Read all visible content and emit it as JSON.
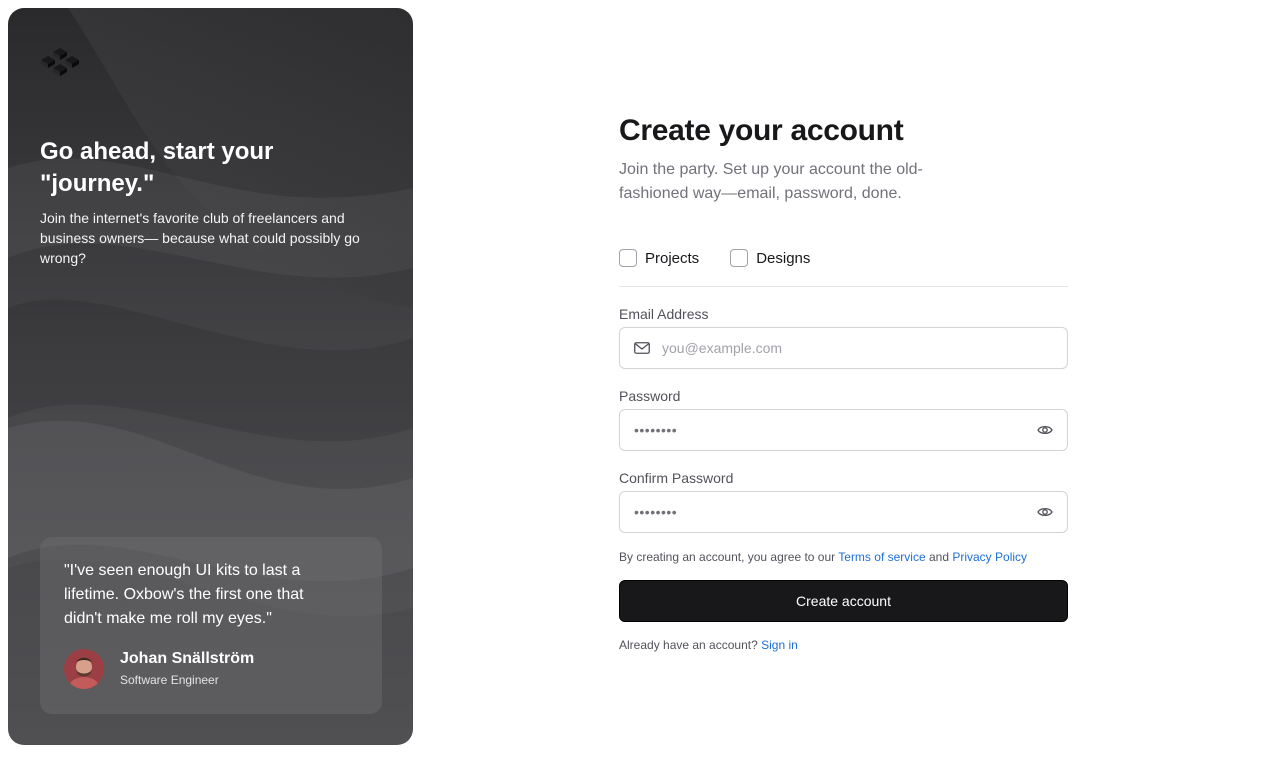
{
  "hero": {
    "title": "Go ahead, start your \"journey.\"",
    "subtitle": "Join the internet's favorite club of freelancers and business owners— because what could possibly go wrong?",
    "logo_icon": "cubes-logo-icon",
    "quote": {
      "text": "\"I've seen enough UI kits to last a lifetime. Oxbow's the first one that didn't make me roll my eyes.\"",
      "author_name": "Johan Snällström",
      "author_role": "Software Engineer"
    }
  },
  "form": {
    "title": "Create your account",
    "subtitle": "Join the party. Set up your account the old-fashioned way—email, password, done.",
    "checkboxes": [
      {
        "label": "Projects",
        "checked": false
      },
      {
        "label": "Designs",
        "checked": false
      }
    ],
    "email": {
      "label": "Email Address",
      "placeholder": "you@example.com",
      "icon": "mail-icon"
    },
    "password": {
      "label": "Password",
      "value": "••••••••",
      "icon": "eye-icon"
    },
    "confirm_password": {
      "label": "Confirm Password",
      "value": "••••••••",
      "icon": "eye-icon"
    },
    "terms": {
      "prefix": "By creating an account, you agree to our",
      "terms_link": "Terms of service",
      "and": "and",
      "privacy_link": "Privacy Policy"
    },
    "submit_label": "Create account",
    "signin": {
      "prompt": "Already have an account?",
      "link": "Sign in"
    }
  },
  "colors": {
    "accent_link": "#1e6fd9",
    "button_bg": "#18181b",
    "hero_bg": "#3a3a3d"
  }
}
